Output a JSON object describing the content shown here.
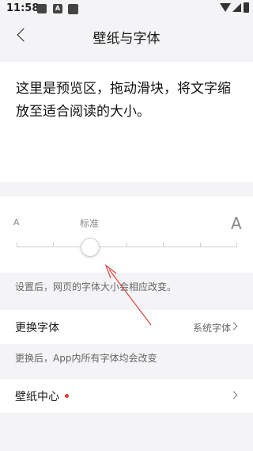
{
  "status_bar": {
    "time": "11:58",
    "icons": [
      "image-icon",
      "a-icon",
      "square-icon",
      "wifi-icon",
      "signal-icon",
      "battery-icon"
    ],
    "a_glyph": "A"
  },
  "header": {
    "title": "壁纸与字体",
    "back_icon": "back-arrow-icon"
  },
  "preview": {
    "text": "这里是预览区，拖动滑块，将文字缩放至适合阅读的大小。"
  },
  "font_size": {
    "small_label": "A",
    "standard_label": "标准",
    "large_label": "A",
    "ticks_count": 7,
    "selected_index": 2,
    "hint": "设置后，网页的字体大小会相应改变。"
  },
  "change_font": {
    "label": "更换字体",
    "value": "系统字体",
    "hint": "更换后，App内所有字体均会改变"
  },
  "wallpaper": {
    "label": "壁纸中心",
    "badge_color": "#e83a2f"
  },
  "colors": {
    "accent_red": "#e83a2f",
    "annotation_arrow": "#d9413c"
  }
}
